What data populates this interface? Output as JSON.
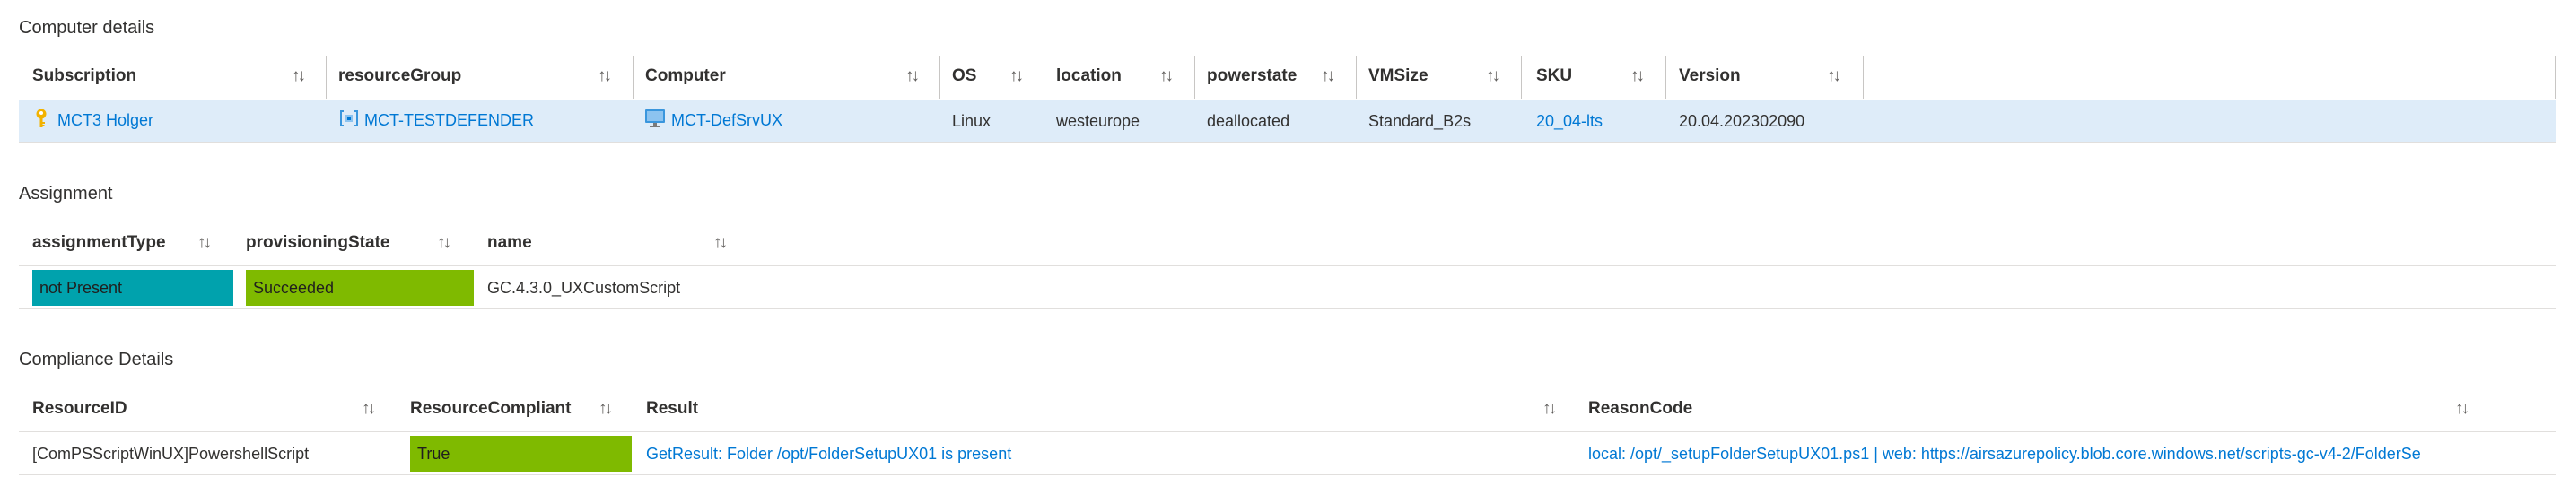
{
  "computer_details": {
    "title": "Computer details",
    "columns": [
      "Subscription",
      "resourceGroup",
      "Computer",
      "OS",
      "location",
      "powerstate",
      "VMSize",
      "SKU",
      "Version"
    ],
    "row": {
      "subscription": "MCT3 Holger",
      "resourceGroup": "MCT-TESTDEFENDER",
      "computer": "MCT-DefSrvUX",
      "os": "Linux",
      "location": "westeurope",
      "powerstate": "deallocated",
      "vmsize": "Standard_B2s",
      "sku": "20_04-lts",
      "version": "20.04.202302090"
    }
  },
  "assignment": {
    "title": "Assignment",
    "columns": [
      "assignmentType",
      "provisioningState",
      "name"
    ],
    "row": {
      "assignmentType": "not Present",
      "provisioningState": "Succeeded",
      "name": "GC.4.3.0_UXCustomScript"
    }
  },
  "compliance": {
    "title": "Compliance Details",
    "columns": [
      "ResourceID",
      "ResourceCompliant",
      "Result",
      "ReasonCode"
    ],
    "row": {
      "resourceId": "[ComPSScriptWinUX]PowershellScript",
      "resourceCompliant": "True",
      "result": "GetResult: Folder /opt/FolderSetupUX01 is present",
      "reasonCode": "local: /opt/_setupFolderSetupUX01.ps1 | web: https://airsazurepolicy.blob.core.windows.net/scripts-gc-v4-2/FolderSe"
    }
  },
  "sort_glyph": "↑↓",
  "colors": {
    "link": "#0078d4",
    "row_highlight": "#deecf9",
    "teal_badge": "#00a2ad",
    "green_badge": "#7fba00",
    "key_icon": "#f2b200",
    "monitor_icon": "#3a96dd"
  }
}
